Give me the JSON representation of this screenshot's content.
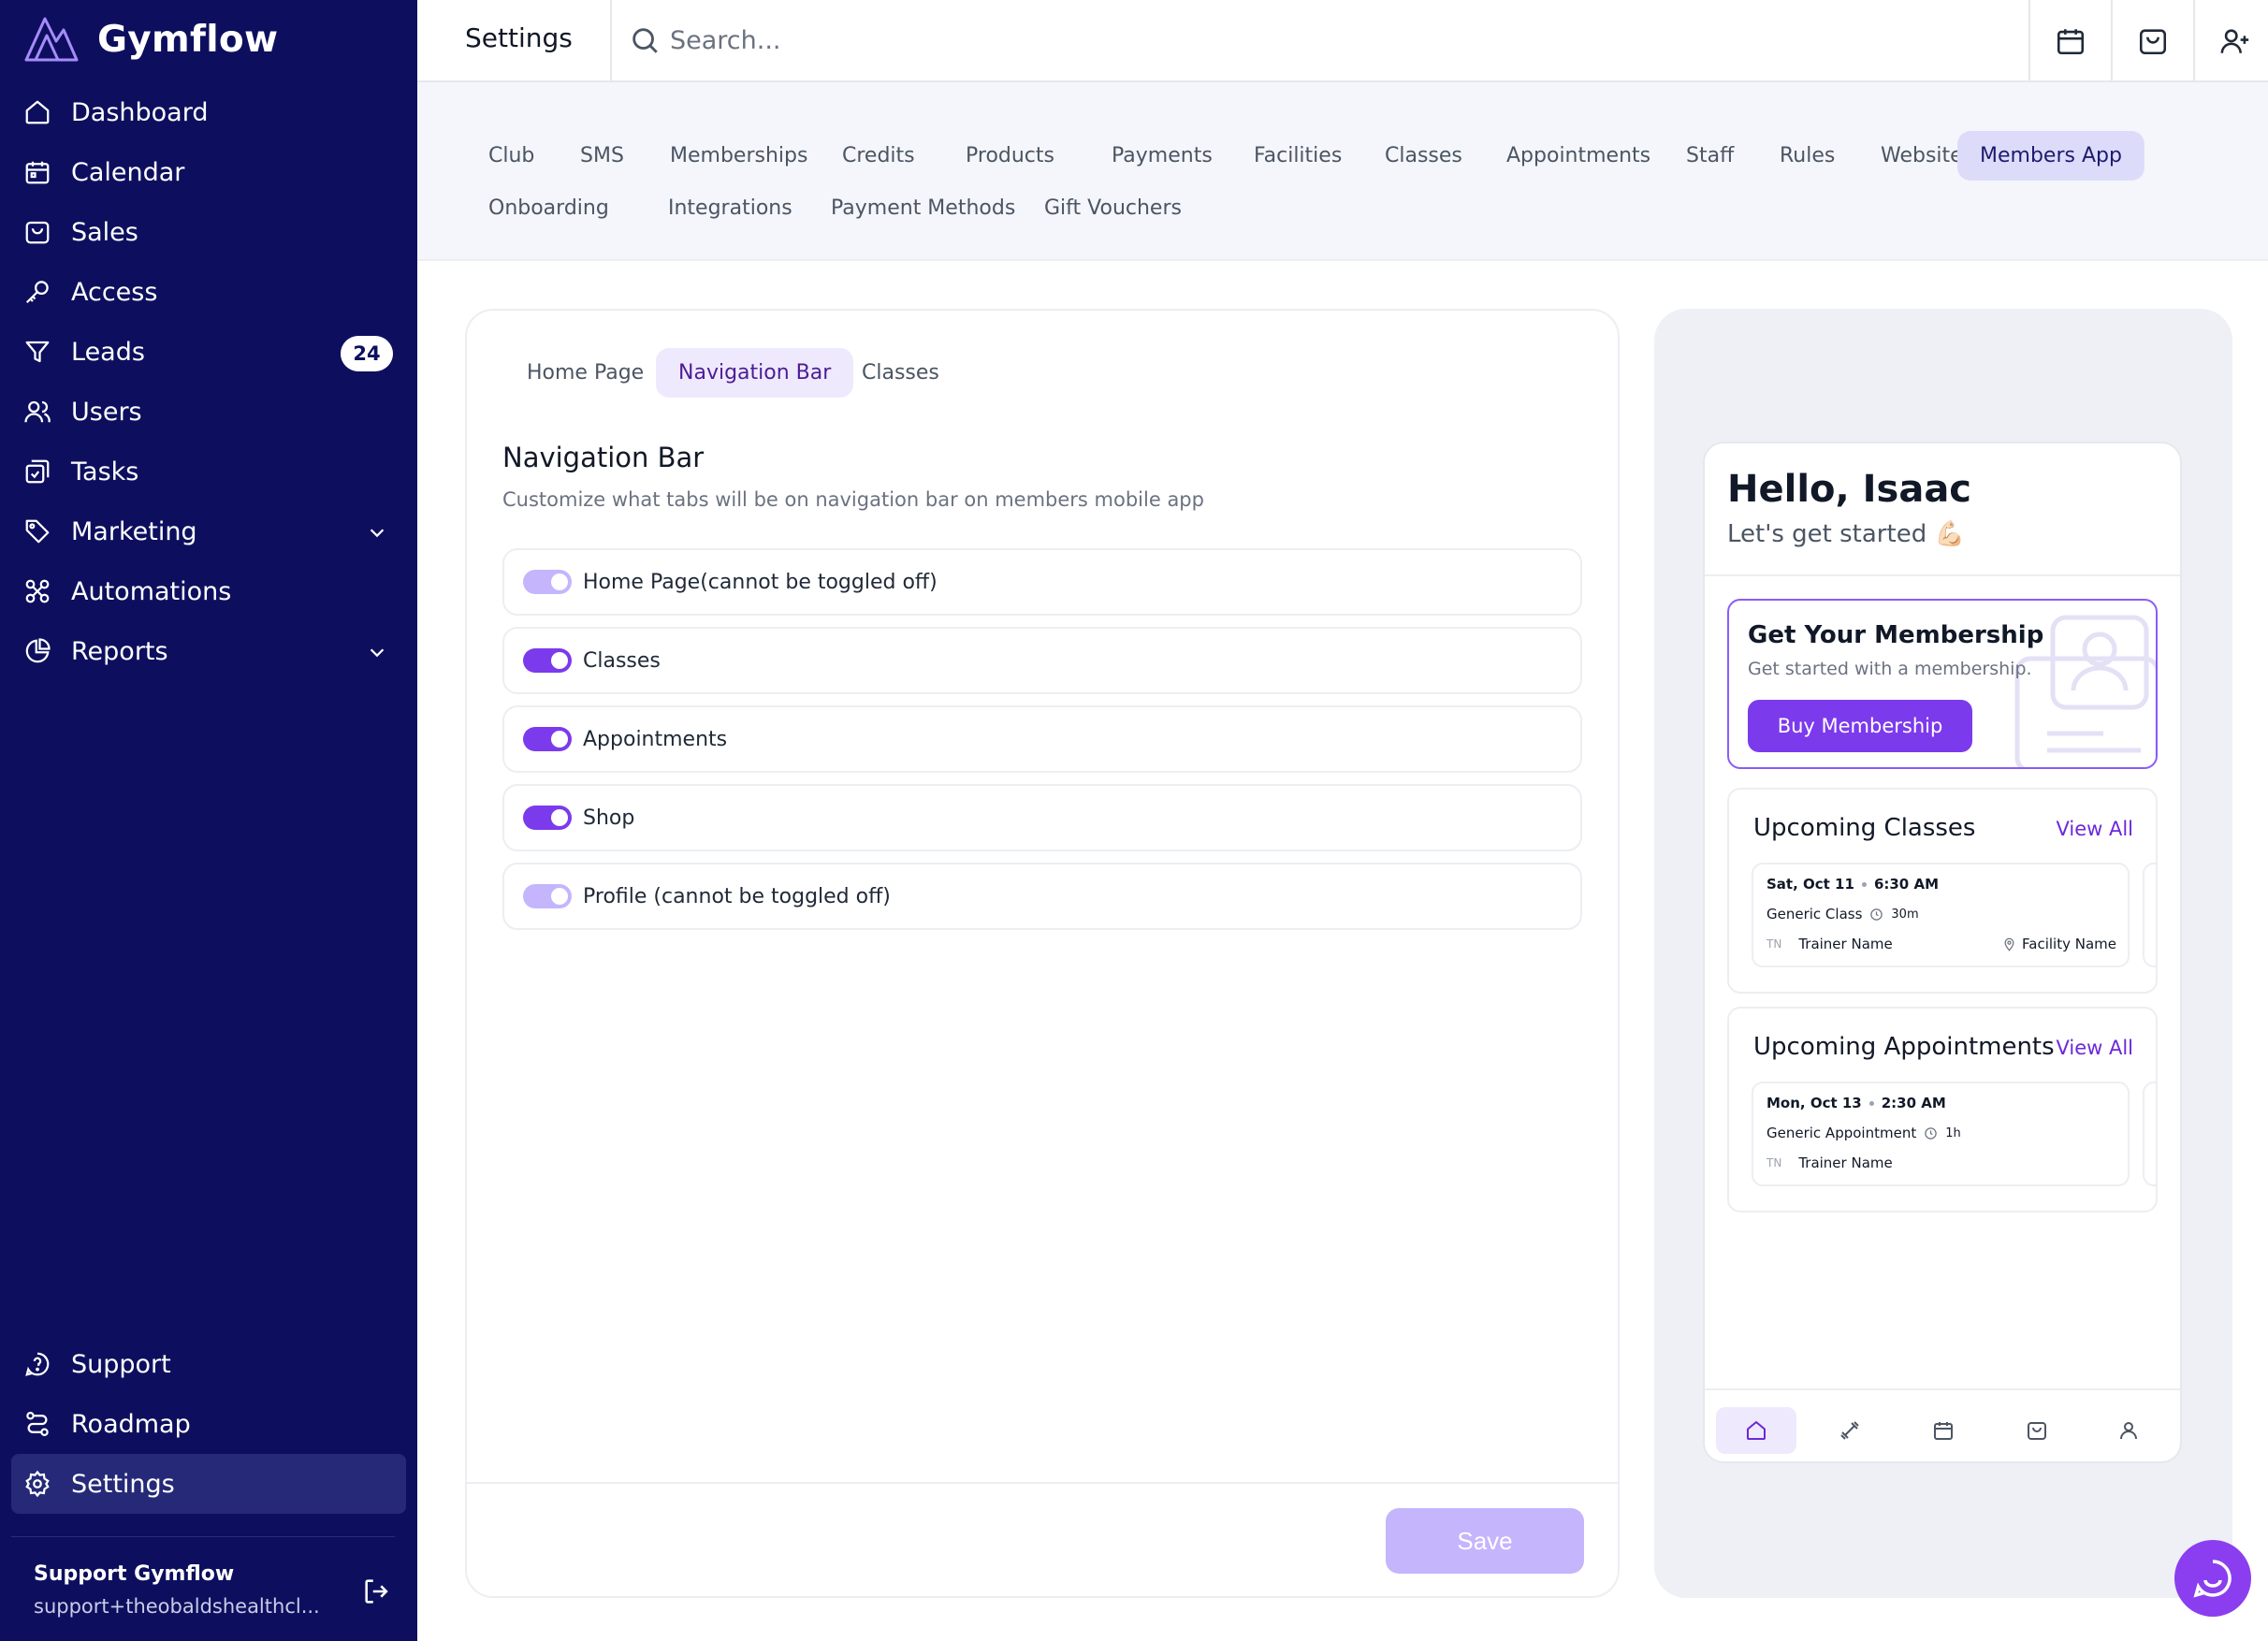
{
  "brand": {
    "name": "Gymflow"
  },
  "sidebar": {
    "items": [
      {
        "label": "Dashboard",
        "icon": "home-icon"
      },
      {
        "label": "Calendar",
        "icon": "calendar-icon"
      },
      {
        "label": "Sales",
        "icon": "shopping-bag-icon"
      },
      {
        "label": "Access",
        "icon": "key-icon"
      },
      {
        "label": "Leads",
        "icon": "filter-icon",
        "badge": "24"
      },
      {
        "label": "Users",
        "icon": "users-icon"
      },
      {
        "label": "Tasks",
        "icon": "tasks-icon"
      },
      {
        "label": "Marketing",
        "icon": "tag-icon",
        "expandable": true
      },
      {
        "label": "Automations",
        "icon": "automation-icon"
      },
      {
        "label": "Reports",
        "icon": "pie-chart-icon",
        "expandable": true
      }
    ],
    "bottom_items": [
      {
        "label": "Support",
        "icon": "chat-help-icon"
      },
      {
        "label": "Roadmap",
        "icon": "route-icon"
      },
      {
        "label": "Settings",
        "icon": "gear-icon",
        "active": true
      }
    ],
    "account": {
      "name": "Support Gymflow",
      "email": "support+theobaldshealthcl..."
    }
  },
  "topbar": {
    "title": "Settings",
    "search_placeholder": "Search...",
    "icons": [
      "calendar-icon",
      "shopping-bag-icon",
      "user-plus-icon"
    ]
  },
  "settings_tabs": {
    "row1": [
      "Club",
      "SMS",
      "Memberships",
      "Credits",
      "Products",
      "Payments",
      "Facilities",
      "Classes",
      "Appointments",
      "Staff",
      "Rules",
      "Website",
      "Members App"
    ],
    "row2": [
      "Onboarding",
      "Integrations",
      "Payment Methods",
      "Gift Vouchers"
    ],
    "active": "Members App"
  },
  "card": {
    "tabs": [
      "Home Page",
      "Navigation Bar",
      "Classes"
    ],
    "active_tab": "Navigation Bar",
    "title": "Navigation Bar",
    "subtitle": "Customize what tabs will be on navigation bar on members mobile app",
    "toggles": [
      {
        "label": "Home Page(cannot be toggled off)",
        "on": true,
        "disabled": true
      },
      {
        "label": "Classes",
        "on": true,
        "disabled": false
      },
      {
        "label": "Appointments",
        "on": true,
        "disabled": false
      },
      {
        "label": "Shop",
        "on": true,
        "disabled": false
      },
      {
        "label": "Profile (cannot be toggled off)",
        "on": true,
        "disabled": true
      }
    ],
    "save_label": "Save"
  },
  "preview": {
    "greeting": "Hello, Isaac",
    "greeting_sub": "Let's get started 💪🏻",
    "membership": {
      "title": "Get Your Membership",
      "subtitle": "Get started with a membership.",
      "button": "Buy Membership"
    },
    "classes": {
      "title": "Upcoming Classes",
      "link": "View All",
      "item": {
        "date": "Sat, Oct 11",
        "time": "6:30 AM",
        "name": "Generic Class",
        "duration": "30m",
        "initials": "TN",
        "trainer": "Trainer Name",
        "facility": "Facility Name"
      }
    },
    "appointments": {
      "title": "Upcoming Appointments",
      "link": "View All",
      "item": {
        "date": "Mon, Oct 13",
        "time": "2:30 AM",
        "name": "Generic Appointment",
        "duration": "1h",
        "initials": "TN",
        "trainer": "Trainer Name"
      }
    },
    "bottom_nav": [
      "home-icon",
      "dumbbell-icon",
      "calendar-icon",
      "shopping-bag-icon",
      "user-icon"
    ]
  },
  "colors": {
    "sidebar": "#0d0f5e",
    "accent": "#7c3aed",
    "accent_light": "#c4b5fd",
    "tab_active": "#dcdcfa"
  }
}
